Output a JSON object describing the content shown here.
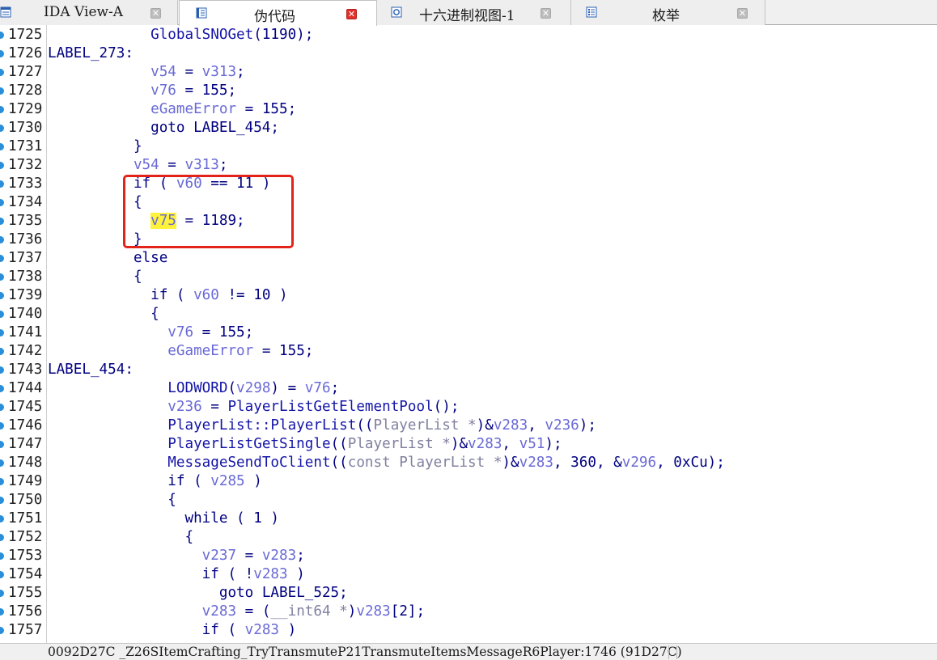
{
  "tabs": [
    {
      "label": "IDA View-A",
      "icon": "disassembly-view-icon",
      "active": false
    },
    {
      "label": "伪代码",
      "icon": "pseudocode-view-icon",
      "active": true
    },
    {
      "label": "十六进制视图-1",
      "icon": "hex-view-icon",
      "active": false
    },
    {
      "label": "枚举",
      "icon": "enums-view-icon",
      "active": false
    }
  ],
  "code": {
    "highlight_color": "#fff23a",
    "annotation_color": "#e2231a",
    "lines": [
      {
        "n": "1725",
        "t": [
          [
            "",
            "            "
          ],
          [
            "fn",
            "GlobalSNOGet"
          ],
          [
            "op",
            "(1190);"
          ]
        ]
      },
      {
        "n": "1726",
        "t": [
          [
            "label",
            "LABEL_273:"
          ]
        ]
      },
      {
        "n": "1727",
        "t": [
          [
            "",
            "            "
          ],
          [
            "var",
            "v54"
          ],
          [
            "op",
            " = "
          ],
          [
            "var",
            "v313"
          ],
          [
            "op",
            ";"
          ]
        ]
      },
      {
        "n": "1728",
        "t": [
          [
            "",
            "            "
          ],
          [
            "var",
            "v76"
          ],
          [
            "op",
            " = 155;"
          ]
        ]
      },
      {
        "n": "1729",
        "t": [
          [
            "",
            "            "
          ],
          [
            "var",
            "eGameError"
          ],
          [
            "op",
            " = 155;"
          ]
        ]
      },
      {
        "n": "1730",
        "t": [
          [
            "",
            "            "
          ],
          [
            "kw",
            "goto LABEL_454;"
          ]
        ]
      },
      {
        "n": "1731",
        "t": [
          [
            "",
            "          "
          ],
          [
            "op",
            "}"
          ]
        ]
      },
      {
        "n": "1732",
        "t": [
          [
            "",
            "          "
          ],
          [
            "var",
            "v54"
          ],
          [
            "op",
            " = "
          ],
          [
            "var",
            "v313"
          ],
          [
            "op",
            ";"
          ]
        ]
      },
      {
        "n": "1733",
        "t": [
          [
            "",
            "          "
          ],
          [
            "kw",
            "if"
          ],
          [
            "op",
            " ( "
          ],
          [
            "var",
            "v60"
          ],
          [
            "op",
            " == 11 )"
          ]
        ]
      },
      {
        "n": "1734",
        "t": [
          [
            "",
            "          "
          ],
          [
            "op",
            "{"
          ]
        ]
      },
      {
        "n": "1735",
        "t": [
          [
            "",
            "            "
          ],
          [
            "hl",
            "v75"
          ],
          [
            "op",
            " = 1189;"
          ]
        ]
      },
      {
        "n": "1736",
        "t": [
          [
            "",
            "          "
          ],
          [
            "op",
            "}"
          ]
        ]
      },
      {
        "n": "1737",
        "t": [
          [
            "",
            "          "
          ],
          [
            "kw",
            "else"
          ]
        ]
      },
      {
        "n": "1738",
        "t": [
          [
            "",
            "          "
          ],
          [
            "op",
            "{"
          ]
        ]
      },
      {
        "n": "1739",
        "t": [
          [
            "",
            "            "
          ],
          [
            "kw",
            "if"
          ],
          [
            "op",
            " ( "
          ],
          [
            "var",
            "v60"
          ],
          [
            "op",
            " != 10 )"
          ]
        ]
      },
      {
        "n": "1740",
        "t": [
          [
            "",
            "            "
          ],
          [
            "op",
            "{"
          ]
        ]
      },
      {
        "n": "1741",
        "t": [
          [
            "",
            "              "
          ],
          [
            "var",
            "v76"
          ],
          [
            "op",
            " = 155;"
          ]
        ]
      },
      {
        "n": "1742",
        "t": [
          [
            "",
            "              "
          ],
          [
            "var",
            "eGameError"
          ],
          [
            "op",
            " = 155;"
          ]
        ]
      },
      {
        "n": "1743",
        "t": [
          [
            "label",
            "LABEL_454:"
          ]
        ]
      },
      {
        "n": "1744",
        "t": [
          [
            "",
            "              "
          ],
          [
            "fn",
            "LODWORD"
          ],
          [
            "op",
            "("
          ],
          [
            "var",
            "v298"
          ],
          [
            "op",
            ") = "
          ],
          [
            "var",
            "v76"
          ],
          [
            "op",
            ";"
          ]
        ]
      },
      {
        "n": "1745",
        "t": [
          [
            "",
            "              "
          ],
          [
            "var",
            "v236"
          ],
          [
            "op",
            " = "
          ],
          [
            "fn",
            "PlayerListGetElementPool"
          ],
          [
            "op",
            "();"
          ]
        ]
      },
      {
        "n": "1746",
        "t": [
          [
            "",
            "              "
          ],
          [
            "fn",
            "PlayerList::PlayerList"
          ],
          [
            "op",
            "(("
          ],
          [
            "type",
            "PlayerList *"
          ],
          [
            "op",
            ")&"
          ],
          [
            "var",
            "v283"
          ],
          [
            "op",
            ", "
          ],
          [
            "var",
            "v236"
          ],
          [
            "op",
            ");"
          ]
        ]
      },
      {
        "n": "1747",
        "t": [
          [
            "",
            "              "
          ],
          [
            "fn",
            "PlayerListGetSingle"
          ],
          [
            "op",
            "(("
          ],
          [
            "type",
            "PlayerList *"
          ],
          [
            "op",
            ")&"
          ],
          [
            "var",
            "v283"
          ],
          [
            "op",
            ", "
          ],
          [
            "var",
            "v51"
          ],
          [
            "op",
            ");"
          ]
        ]
      },
      {
        "n": "1748",
        "t": [
          [
            "",
            "              "
          ],
          [
            "fn",
            "MessageSendToClient"
          ],
          [
            "op",
            "(("
          ],
          [
            "type",
            "const PlayerList *"
          ],
          [
            "op",
            ")&"
          ],
          [
            "var",
            "v283"
          ],
          [
            "op",
            ", 360, &"
          ],
          [
            "var",
            "v296"
          ],
          [
            "op",
            ", 0xCu);"
          ]
        ]
      },
      {
        "n": "1749",
        "t": [
          [
            "",
            "              "
          ],
          [
            "kw",
            "if"
          ],
          [
            "op",
            " ( "
          ],
          [
            "var",
            "v285"
          ],
          [
            "op",
            " )"
          ]
        ]
      },
      {
        "n": "1750",
        "t": [
          [
            "",
            "              "
          ],
          [
            "op",
            "{"
          ]
        ]
      },
      {
        "n": "1751",
        "t": [
          [
            "",
            "                "
          ],
          [
            "kw",
            "while"
          ],
          [
            "op",
            " ( 1 )"
          ]
        ]
      },
      {
        "n": "1752",
        "t": [
          [
            "",
            "                "
          ],
          [
            "op",
            "{"
          ]
        ]
      },
      {
        "n": "1753",
        "t": [
          [
            "",
            "                  "
          ],
          [
            "var",
            "v237"
          ],
          [
            "op",
            " = "
          ],
          [
            "var",
            "v283"
          ],
          [
            "op",
            ";"
          ]
        ]
      },
      {
        "n": "1754",
        "t": [
          [
            "",
            "                  "
          ],
          [
            "kw",
            "if"
          ],
          [
            "op",
            " ( !"
          ],
          [
            "var",
            "v283"
          ],
          [
            "op",
            " )"
          ]
        ]
      },
      {
        "n": "1755",
        "t": [
          [
            "",
            "                    "
          ],
          [
            "kw",
            "goto LABEL_525;"
          ]
        ]
      },
      {
        "n": "1756",
        "t": [
          [
            "",
            "                  "
          ],
          [
            "var",
            "v283"
          ],
          [
            "op",
            " = ("
          ],
          [
            "type",
            "__int64 *"
          ],
          [
            "op",
            ")"
          ],
          [
            "var",
            "v283"
          ],
          [
            "op",
            "[2];"
          ]
        ]
      },
      {
        "n": "1757",
        "t": [
          [
            "",
            "                  "
          ],
          [
            "kw",
            "if"
          ],
          [
            "op",
            " ( "
          ],
          [
            "var",
            "v283"
          ],
          [
            "op",
            " )"
          ]
        ]
      }
    ]
  },
  "status": {
    "location": "0092D27C _Z26SItemCrafting_TryTransmuteP21TransmuteItemsMessageR6Player:1746 (91D27C)"
  }
}
